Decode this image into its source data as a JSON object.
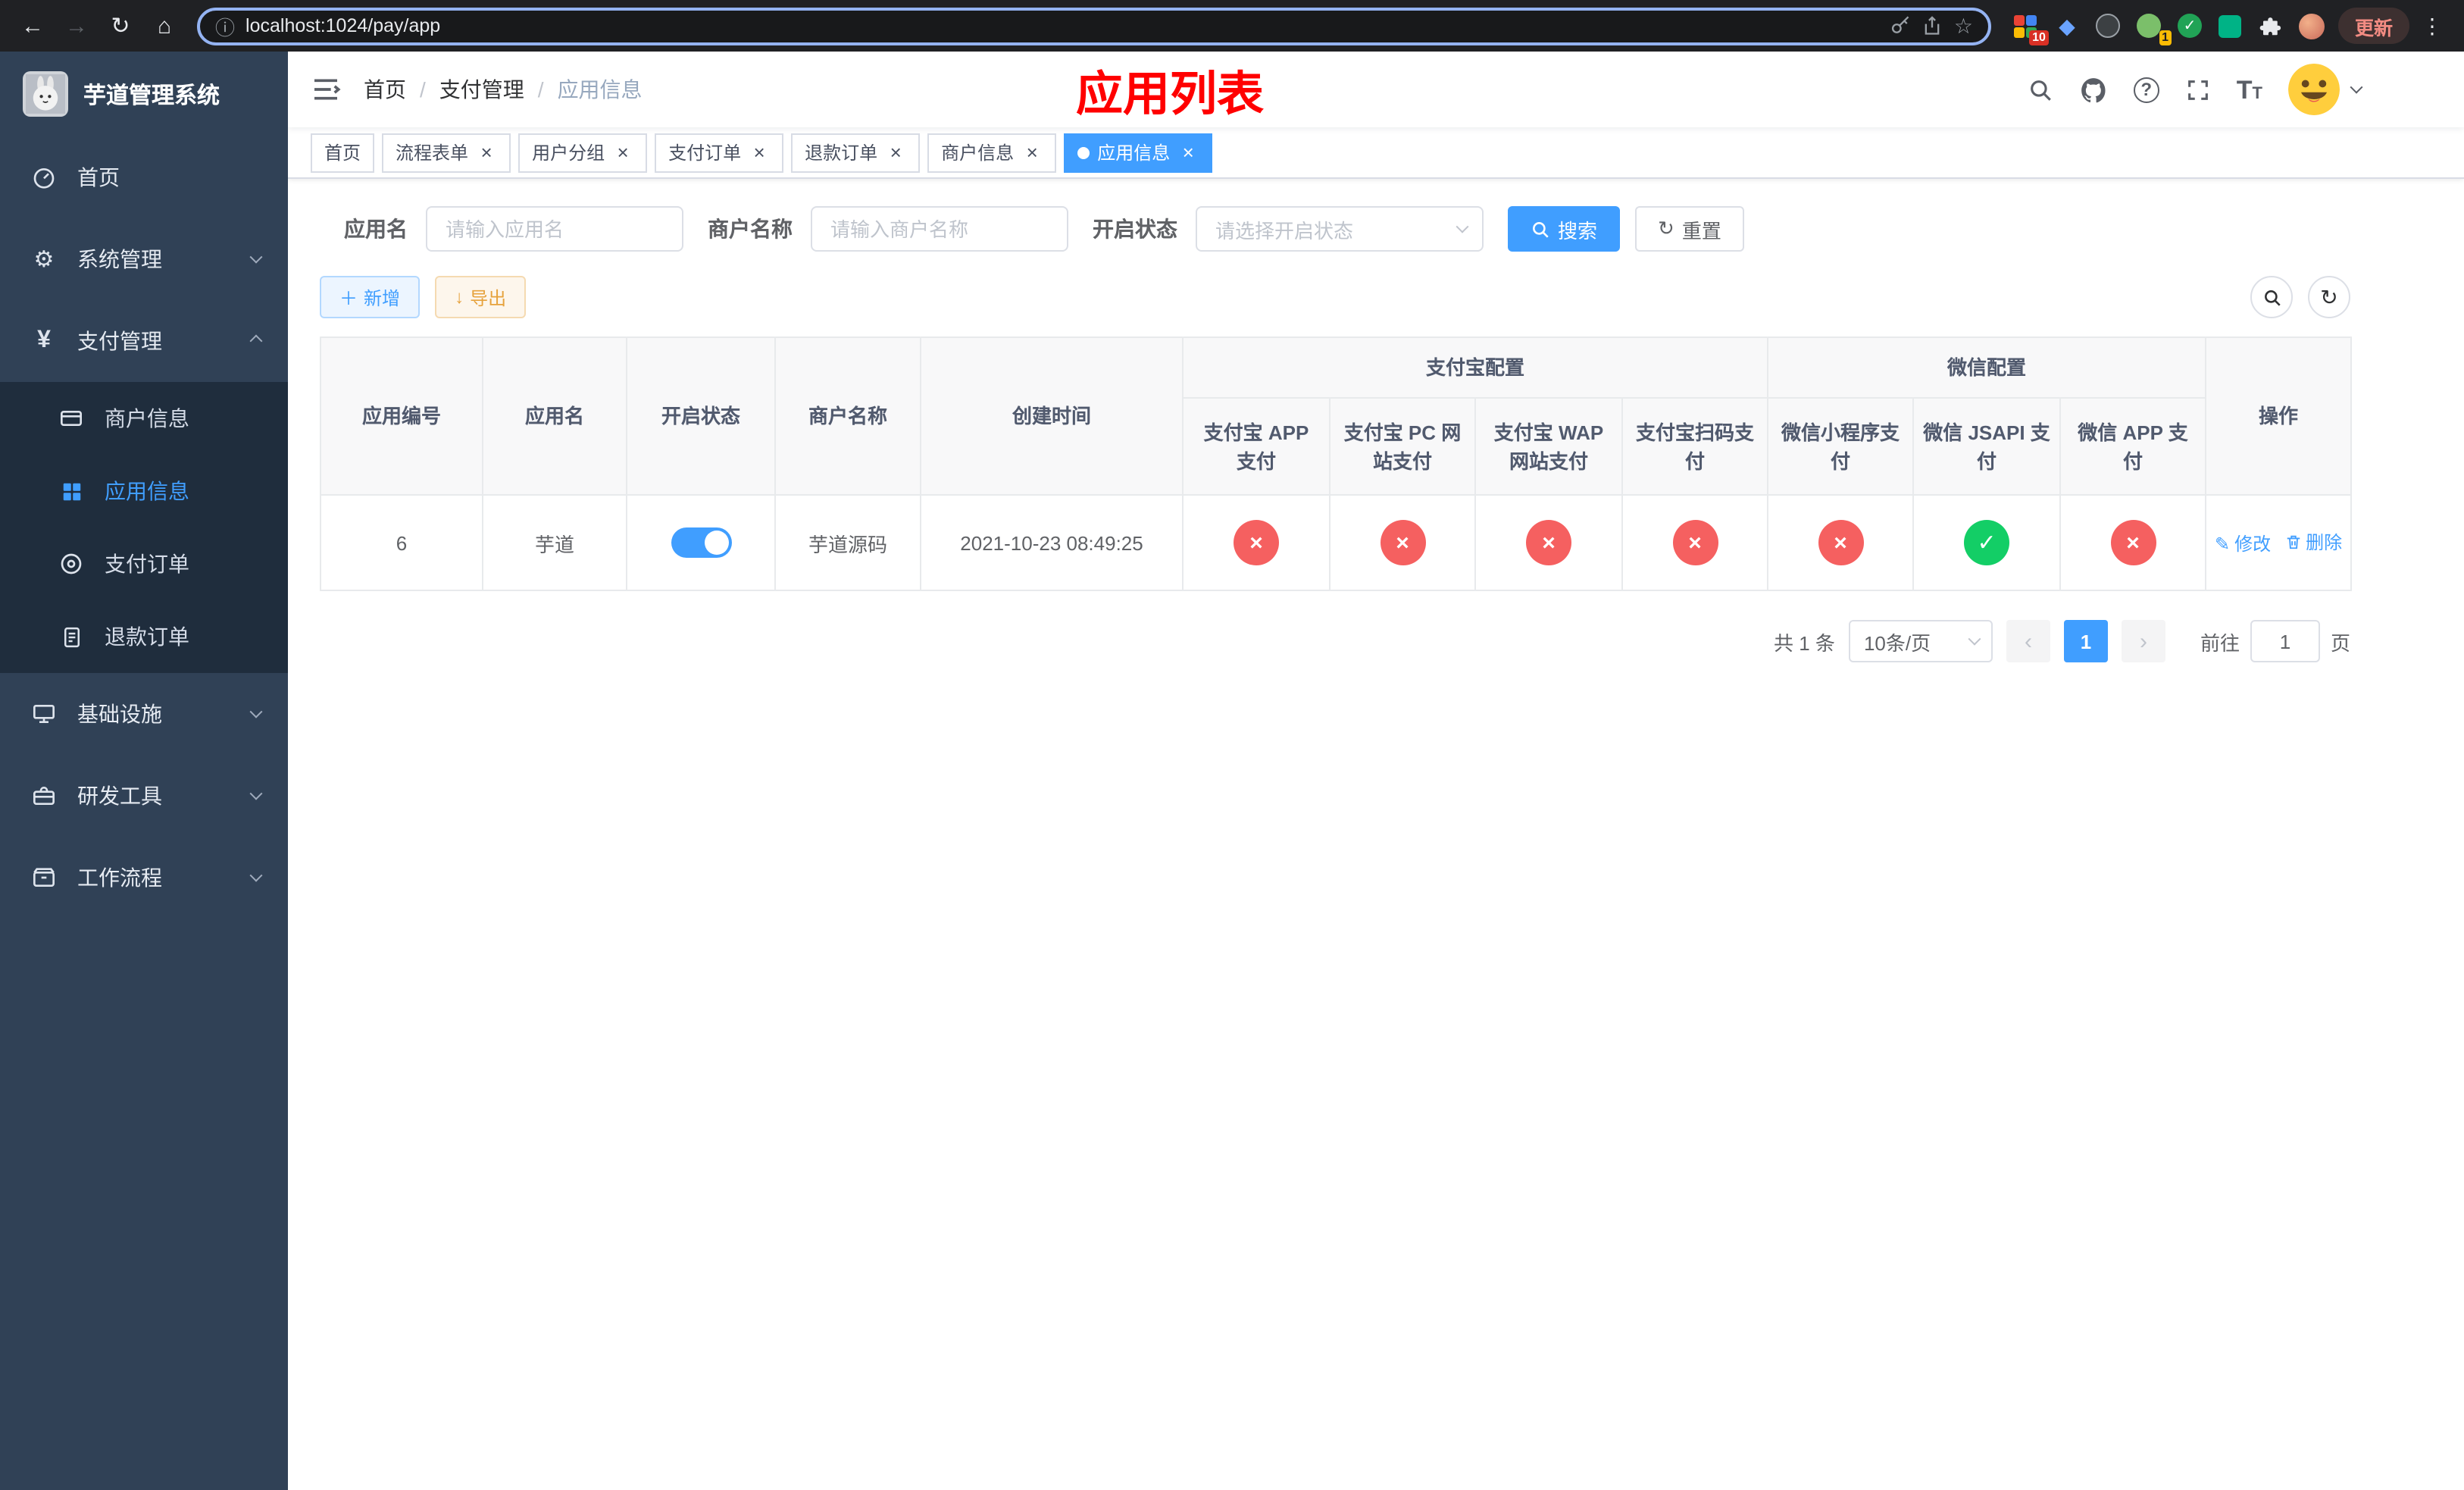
{
  "browser": {
    "url": "localhost:1024/pay/app",
    "update_label": "更新",
    "extension_badge": "10",
    "avatar_badge": "1"
  },
  "sidebar": {
    "title": "芋道管理系统",
    "items": [
      {
        "label": "首页"
      },
      {
        "label": "系统管理"
      },
      {
        "label": "支付管理",
        "children": [
          {
            "label": "商户信息"
          },
          {
            "label": "应用信息"
          },
          {
            "label": "支付订单"
          },
          {
            "label": "退款订单"
          }
        ]
      },
      {
        "label": "基础设施"
      },
      {
        "label": "研发工具"
      },
      {
        "label": "工作流程"
      }
    ]
  },
  "header": {
    "breadcrumb": [
      "首页",
      "支付管理",
      "应用信息"
    ],
    "page_title": "应用列表"
  },
  "tabs": [
    {
      "label": "首页",
      "closable": false,
      "active": false
    },
    {
      "label": "流程表单",
      "closable": true,
      "active": false
    },
    {
      "label": "用户分组",
      "closable": true,
      "active": false
    },
    {
      "label": "支付订单",
      "closable": true,
      "active": false
    },
    {
      "label": "退款订单",
      "closable": true,
      "active": false
    },
    {
      "label": "商户信息",
      "closable": true,
      "active": false
    },
    {
      "label": "应用信息",
      "closable": true,
      "active": true
    }
  ],
  "filters": {
    "app_name_label": "应用名",
    "app_name_placeholder": "请输入应用名",
    "app_name_value": "",
    "merchant_label": "商户名称",
    "merchant_placeholder": "请输入商户名称",
    "merchant_value": "",
    "status_label": "开启状态",
    "status_placeholder": "请选择开启状态",
    "search_label": "搜索",
    "reset_label": "重置"
  },
  "toolbar": {
    "add_label": "新增",
    "export_label": "导出"
  },
  "table": {
    "group_headers": {
      "alipay": "支付宝配置",
      "wechat": "微信配置"
    },
    "columns": {
      "id": "应用编号",
      "name": "应用名",
      "status": "开启状态",
      "merchant": "商户名称",
      "created": "创建时间",
      "alipay_app": "支付宝 APP 支付",
      "alipay_pc": "支付宝 PC 网站支付",
      "alipay_wap": "支付宝 WAP 网站支付",
      "alipay_qr": "支付宝扫码支付",
      "wx_mini": "微信小程序支付",
      "wx_jsapi": "微信 JSAPI 支付",
      "wx_app": "微信 APP 支付",
      "actions": "操作"
    },
    "rows": [
      {
        "id": "6",
        "name": "芋道",
        "status_on": true,
        "merchant": "芋道源码",
        "created": "2021-10-23 08:49:25",
        "configs": [
          false,
          false,
          false,
          false,
          false,
          true,
          false
        ],
        "edit_label": "修改",
        "delete_label": "删除"
      }
    ]
  },
  "pagination": {
    "total": "共 1 条",
    "page_size": "10条/页",
    "current": "1",
    "jump_prefix": "前往",
    "jump_value": "1",
    "jump_suffix": "页"
  },
  "colors": {
    "accent": "#409eff",
    "danger": "#f56060",
    "success": "#13ce66",
    "title_red": "#ff0000",
    "sidebar_bg": "#304156",
    "submenu_bg": "#1f2d3d"
  }
}
